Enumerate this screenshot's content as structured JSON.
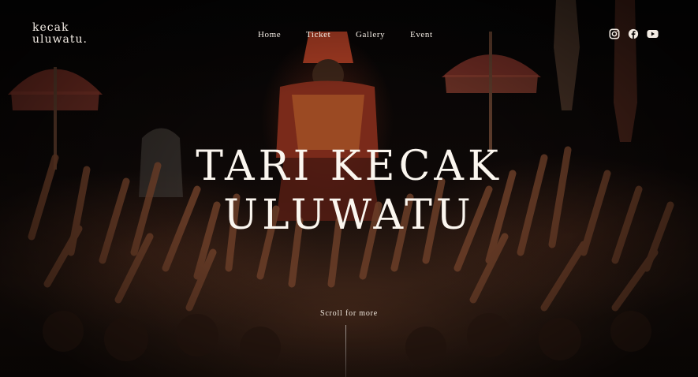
{
  "logo": {
    "line1": "kecak",
    "line2": "uluwatu."
  },
  "nav": {
    "items": [
      {
        "label": "Home"
      },
      {
        "label": "Ticket"
      },
      {
        "label": "Gallery"
      },
      {
        "label": "Event"
      }
    ]
  },
  "social": {
    "icons": [
      "instagram-icon",
      "facebook-icon",
      "youtube-icon"
    ]
  },
  "hero": {
    "title_line1": "TARI KECAK",
    "title_line2": "ULUWATU"
  },
  "scroll": {
    "label": "Scroll for more"
  },
  "colors": {
    "text": "#f3ece4",
    "background": "#0a0706",
    "accent": "#b8432a"
  }
}
